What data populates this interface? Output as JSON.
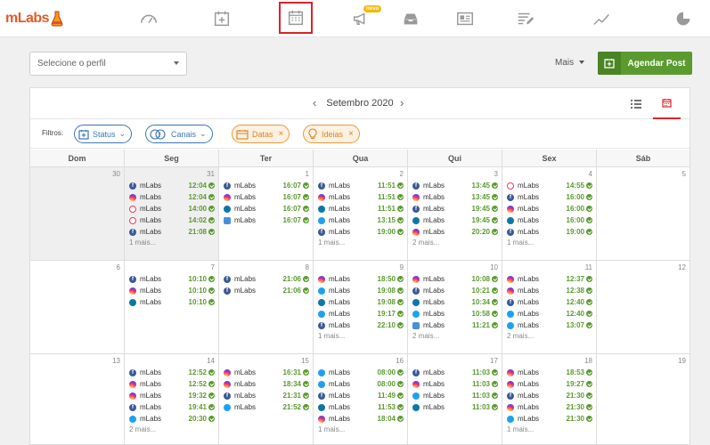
{
  "app": {
    "logo_text": "mLabs"
  },
  "nav": {
    "items": [
      {
        "name": "dashboard-icon"
      },
      {
        "name": "add-calendar-icon"
      },
      {
        "name": "calendar-icon",
        "active": true
      },
      {
        "name": "megaphone-icon",
        "badge": "novo"
      },
      {
        "name": "inbox-icon"
      },
      {
        "name": "newspaper-icon"
      },
      {
        "name": "edit-list-icon"
      },
      {
        "name": "analytics-line-icon"
      },
      {
        "name": "pie-chart-icon"
      }
    ]
  },
  "controls": {
    "profile_placeholder": "Selecione o perfil",
    "more_label": "Mais",
    "schedule_label": "Agendar Post"
  },
  "calendar": {
    "month_title": "Setembro 2020",
    "filters_label": "Filtros:",
    "chips": [
      {
        "label": "Status",
        "style": "blue"
      },
      {
        "label": "Canais",
        "style": "blue"
      },
      {
        "label": "Datas",
        "style": "orange"
      },
      {
        "label": "Ideias",
        "style": "orange"
      }
    ],
    "weekdays": [
      "Dom",
      "Seg",
      "Ter",
      "Qua",
      "Qui",
      "Sex",
      "Sáb"
    ],
    "weeks": [
      [
        {
          "num": "30",
          "past": true,
          "posts": []
        },
        {
          "num": "31",
          "past": true,
          "posts": [
            {
              "net": "fb",
              "name": "mLabs",
              "time": "12:04"
            },
            {
              "net": "ig",
              "name": "mLabs",
              "time": "12:04"
            },
            {
              "net": "ig-outline",
              "name": "mLabs",
              "time": "14:00"
            },
            {
              "net": "ig-outline",
              "name": "mLabs",
              "time": "14:02"
            },
            {
              "net": "fb",
              "name": "mLabs",
              "time": "21:08"
            }
          ],
          "more": "1 mais..."
        },
        {
          "num": "1",
          "posts": [
            {
              "net": "fb",
              "name": "mLabs",
              "time": "16:07"
            },
            {
              "net": "ig",
              "name": "mLabs",
              "time": "16:07"
            },
            {
              "net": "li",
              "name": "mLabs",
              "time": "16:07"
            },
            {
              "net": "gmb",
              "name": "mLabs",
              "time": "16:07"
            }
          ]
        },
        {
          "num": "2",
          "posts": [
            {
              "net": "fb",
              "name": "mLabs",
              "time": "11:51"
            },
            {
              "net": "ig",
              "name": "mLabs",
              "time": "11:51"
            },
            {
              "net": "li",
              "name": "mLabs",
              "time": "11:51"
            },
            {
              "net": "tw",
              "name": "mLabs",
              "time": "13:15"
            },
            {
              "net": "fb",
              "name": "mLabs",
              "time": "19:00"
            }
          ],
          "more": "1 mais..."
        },
        {
          "num": "3",
          "posts": [
            {
              "net": "fb",
              "name": "mLabs",
              "time": "13:45"
            },
            {
              "net": "ig",
              "name": "mLabs",
              "time": "13:45"
            },
            {
              "net": "fb",
              "name": "mLabs",
              "time": "19:45"
            },
            {
              "net": "li",
              "name": "mLabs",
              "time": "19:45"
            },
            {
              "net": "ig",
              "name": "mLabs",
              "time": "20:20"
            }
          ],
          "more": "2 mais..."
        },
        {
          "num": "4",
          "posts": [
            {
              "net": "ig-outline",
              "name": "mLabs",
              "time": "14:55"
            },
            {
              "net": "fb",
              "name": "mLabs",
              "time": "16:00"
            },
            {
              "net": "ig",
              "name": "mLabs",
              "time": "16:00"
            },
            {
              "net": "li",
              "name": "mLabs",
              "time": "16:00"
            },
            {
              "net": "fb",
              "name": "mLabs",
              "time": "19:00"
            }
          ],
          "more": "1 mais..."
        },
        {
          "num": "5",
          "posts": []
        }
      ],
      [
        {
          "num": "6",
          "posts": []
        },
        {
          "num": "7",
          "posts": [
            {
              "net": "fb",
              "name": "mLabs",
              "time": "10:10"
            },
            {
              "net": "ig",
              "name": "mLabs",
              "time": "10:10"
            },
            {
              "net": "li",
              "name": "mLabs",
              "time": "10:10"
            }
          ]
        },
        {
          "num": "8",
          "posts": [
            {
              "net": "fb",
              "name": "mLabs",
              "time": "21:06"
            },
            {
              "net": "fb",
              "name": "mLabs",
              "time": "21:06"
            }
          ]
        },
        {
          "num": "9",
          "posts": [
            {
              "net": "ig",
              "name": "mLabs",
              "time": "18:50"
            },
            {
              "net": "tw",
              "name": "mLabs",
              "time": "19:08"
            },
            {
              "net": "li",
              "name": "mLabs",
              "time": "19:08"
            },
            {
              "net": "tw",
              "name": "mLabs",
              "time": "19:17"
            },
            {
              "net": "fb",
              "name": "mLabs",
              "time": "22:10"
            }
          ],
          "more": "1 mais..."
        },
        {
          "num": "10",
          "posts": [
            {
              "net": "ig",
              "name": "mLabs",
              "time": "10:08"
            },
            {
              "net": "fb",
              "name": "mLabs",
              "time": "10:21"
            },
            {
              "net": "li",
              "name": "mLabs",
              "time": "10:34"
            },
            {
              "net": "tw",
              "name": "mLabs",
              "time": "10:58"
            },
            {
              "net": "gmb",
              "name": "mLabs",
              "time": "11:21"
            }
          ],
          "more": "2 mais..."
        },
        {
          "num": "11",
          "posts": [
            {
              "net": "ig",
              "name": "mLabs",
              "time": "12:37"
            },
            {
              "net": "ig",
              "name": "mLabs",
              "time": "12:38"
            },
            {
              "net": "fb",
              "name": "mLabs",
              "time": "12:40"
            },
            {
              "net": "tw",
              "name": "mLabs",
              "time": "12:40"
            },
            {
              "net": "tw",
              "name": "mLabs",
              "time": "13:07"
            }
          ],
          "more": "2 mais..."
        },
        {
          "num": "12",
          "posts": []
        }
      ],
      [
        {
          "num": "13",
          "posts": []
        },
        {
          "num": "14",
          "posts": [
            {
              "net": "fb",
              "name": "mLabs",
              "time": "12:52"
            },
            {
              "net": "ig",
              "name": "mLabs",
              "time": "12:52"
            },
            {
              "net": "ig",
              "name": "mLabs",
              "time": "19:32"
            },
            {
              "net": "fb",
              "name": "mLabs",
              "time": "19:41"
            },
            {
              "net": "tw",
              "name": "mLabs",
              "time": "20:30"
            }
          ],
          "more": "2 mais..."
        },
        {
          "num": "15",
          "posts": [
            {
              "net": "ig",
              "name": "mLabs",
              "time": "16:31"
            },
            {
              "net": "ig",
              "name": "mLabs",
              "time": "18:34"
            },
            {
              "net": "fb",
              "name": "mLabs",
              "time": "21:31"
            },
            {
              "net": "tw",
              "name": "mLabs",
              "time": "21:52"
            }
          ]
        },
        {
          "num": "16",
          "posts": [
            {
              "net": "tw",
              "name": "mLabs",
              "time": "08:00"
            },
            {
              "net": "tw",
              "name": "mLabs",
              "time": "08:00"
            },
            {
              "net": "fb",
              "name": "mLabs",
              "time": "11:49"
            },
            {
              "net": "li",
              "name": "mLabs",
              "time": "11:53"
            },
            {
              "net": "ig",
              "name": "mLabs",
              "time": "18:04"
            }
          ],
          "more": "1 mais..."
        },
        {
          "num": "17",
          "posts": [
            {
              "net": "fb",
              "name": "mLabs",
              "time": "11:03"
            },
            {
              "net": "ig",
              "name": "mLabs",
              "time": "11:03"
            },
            {
              "net": "tw",
              "name": "mLabs",
              "time": "11:03"
            },
            {
              "net": "li",
              "name": "mLabs",
              "time": "11:03"
            }
          ]
        },
        {
          "num": "18",
          "posts": [
            {
              "net": "ig",
              "name": "mLabs",
              "time": "18:53"
            },
            {
              "net": "ig",
              "name": "mLabs",
              "time": "19:27"
            },
            {
              "net": "fb",
              "name": "mLabs",
              "time": "21:30"
            },
            {
              "net": "ig",
              "name": "mLabs",
              "time": "21:30"
            },
            {
              "net": "tw",
              "name": "mLabs",
              "time": "21:30"
            }
          ],
          "more": "1 mais..."
        },
        {
          "num": "19",
          "posts": []
        }
      ]
    ]
  },
  "colors": {
    "accent_red": "#d9232a",
    "green": "#5a9a2e",
    "blue": "#3a76b8",
    "orange": "#e89a3c"
  }
}
